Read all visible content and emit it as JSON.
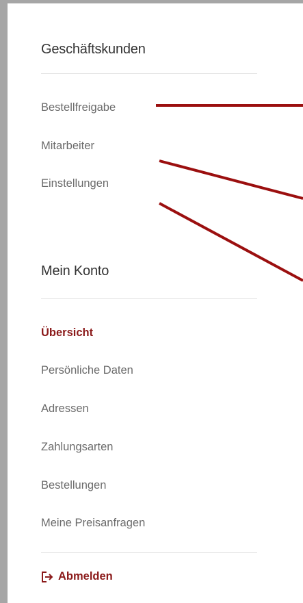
{
  "business": {
    "title": "Geschäftskunden",
    "items": [
      {
        "label": "Bestellfreigabe"
      },
      {
        "label": "Mitarbeiter"
      },
      {
        "label": "Einstellungen"
      }
    ]
  },
  "account": {
    "title": "Mein Konto",
    "items": [
      {
        "label": "Übersicht",
        "active": true
      },
      {
        "label": "Persönliche Daten"
      },
      {
        "label": "Adressen"
      },
      {
        "label": "Zahlungsarten"
      },
      {
        "label": "Bestellungen"
      },
      {
        "label": "Meine Preisanfragen"
      }
    ]
  },
  "logout": {
    "label": "Abmelden",
    "icon": "logout-icon"
  },
  "colors": {
    "accent": "#8b1a1a",
    "annotation_line": "#9b0f0f",
    "text_muted": "#6b6b6b",
    "heading": "#333333",
    "frame": "#a6a6a6"
  }
}
